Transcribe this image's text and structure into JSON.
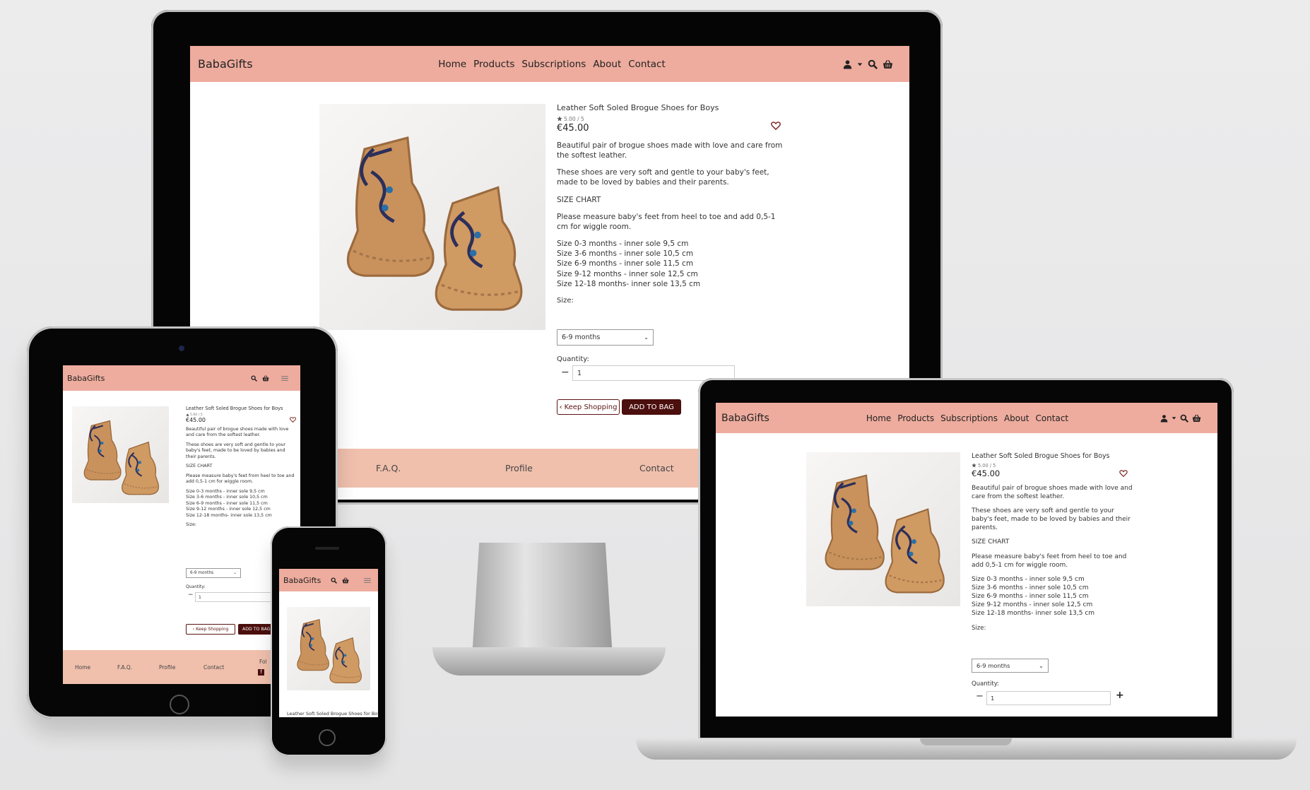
{
  "brand": "BabaGifts",
  "nav": {
    "home": "Home",
    "products": "Products",
    "subscriptions": "Subscriptions",
    "about": "About",
    "contact": "Contact"
  },
  "product": {
    "title": "Leather Soft Soled Brogue Shoes for Boys",
    "rating": "5.00 / 5",
    "price": "€45.00",
    "desc1": "Beautiful pair of brogue shoes made with love and care from the softest leather.",
    "desc2": "These shoes are very soft and gentle to your baby's feet, made to be loved by babies and their parents.",
    "size_chart_heading": "SIZE CHART",
    "measure_note": "Please measure baby's feet from heel to toe and add 0,5-1 cm for wiggle room.",
    "sizes": [
      "Size 0-3 months - inner sole 9,5 cm",
      "Size 3-6 months - inner sole 10,5 cm",
      "Size 6-9 months - inner sole 11,5 cm",
      "Size 9-12 months - inner sole 12,5 cm",
      "Size 12-18 months- inner sole 13,5 cm"
    ],
    "size_label": "Size:",
    "size_value": "6-9 months",
    "quantity_label": "Quantity:",
    "quantity_value": "1"
  },
  "buttons": {
    "keep_shopping": "Keep Shopping",
    "add_to_bag": "ADD TO BAG"
  },
  "footer": {
    "home": "Home",
    "faq": "F.A.Q.",
    "profile": "Profile",
    "contact": "Contact",
    "follow": "Fol"
  },
  "colors": {
    "navbar": "#eeac9e",
    "footer": "#f0c0ad",
    "primary_button": "#4b0f0d",
    "heart": "#7a1c1c"
  },
  "icons": [
    "user-icon",
    "caret-down-icon",
    "search-icon",
    "basket-icon",
    "heart-icon",
    "minus-icon",
    "plus-icon",
    "chevron-left-icon",
    "hamburger-icon",
    "facebook-icon",
    "star-icon"
  ]
}
